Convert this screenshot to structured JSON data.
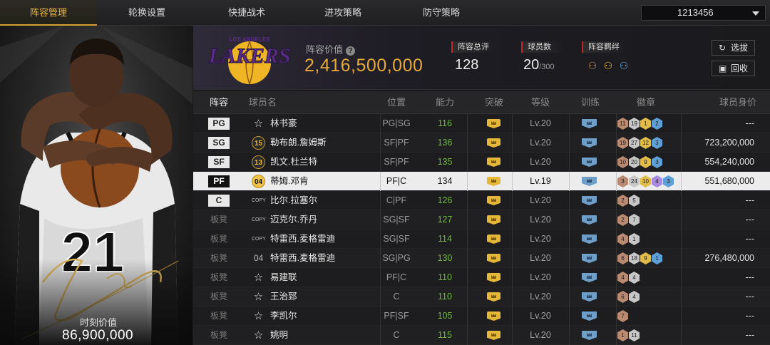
{
  "nav": {
    "tabs": [
      {
        "label": "阵容管理",
        "active": true
      },
      {
        "label": "轮换设置",
        "active": false
      },
      {
        "label": "快捷战术",
        "active": false
      },
      {
        "label": "进攻策略",
        "active": false
      },
      {
        "label": "防守策略",
        "active": false
      }
    ],
    "account_id": "1213456"
  },
  "player_card": {
    "jersey_number": "21",
    "moment_value_label": "时刻价值",
    "moment_value": "86,900,000"
  },
  "summary": {
    "team_logo_text": "LAKERS",
    "team_logo_arc": "LOS ANGELES",
    "lineup_value_label": "阵容价值",
    "lineup_value": "2,416,500,000",
    "overall_label": "阵容总评",
    "overall_value": "128",
    "player_count_label": "球员数",
    "player_count": "20",
    "player_count_max": "/300",
    "bond_label": "阵容羁绊",
    "buttons": {
      "select_label": "选拔",
      "recycle_label": "回收"
    }
  },
  "colors": {
    "accent_gold": "#e6a93a",
    "ability_green": "#6fba3f",
    "brand_red": "#c0262c",
    "lakers_purple": "#552583"
  },
  "table": {
    "headers": [
      "阵容",
      "球员名",
      "位置",
      "能力",
      "突破",
      "等级",
      "训练",
      "徽章",
      "球员身价"
    ],
    "rows": [
      {
        "slot": "PG",
        "slot_type": "starter",
        "jersey": "☆",
        "jersey_type": "star",
        "name": "林书豪",
        "position": "PG|SG",
        "ability": "116",
        "level": "Lv.20",
        "badges": [
          {
            "v": "11",
            "c": "bronze"
          },
          {
            "v": "19",
            "c": "silver"
          },
          {
            "v": "1",
            "c": "gold"
          },
          {
            "v": "2",
            "c": "blue"
          }
        ],
        "price": "---"
      },
      {
        "slot": "SG",
        "slot_type": "starter",
        "jersey": "15",
        "jersey_type": "gold",
        "name": "勒布朗.詹姆斯",
        "position": "SF|PF",
        "ability": "136",
        "level": "Lv.20",
        "badges": [
          {
            "v": "19",
            "c": "bronze"
          },
          {
            "v": "27",
            "c": "silver"
          },
          {
            "v": "12",
            "c": "gold"
          },
          {
            "v": "3",
            "c": "blue"
          }
        ],
        "price": "723,200,000"
      },
      {
        "slot": "SF",
        "slot_type": "starter",
        "jersey": "13",
        "jersey_type": "gold",
        "name": "凯文.杜兰特",
        "position": "SF|PF",
        "ability": "135",
        "level": "Lv.20",
        "badges": [
          {
            "v": "10",
            "c": "bronze"
          },
          {
            "v": "20",
            "c": "silver"
          },
          {
            "v": "9",
            "c": "gold"
          },
          {
            "v": "3",
            "c": "blue"
          }
        ],
        "price": "554,240,000"
      },
      {
        "slot": "PF",
        "slot_type": "starter",
        "selected": true,
        "jersey": "04",
        "jersey_type": "gold",
        "name": "蒂姆.邓肯",
        "position": "PF|C",
        "ability": "134",
        "level": "Lv.19",
        "badges": [
          {
            "v": "3",
            "c": "bronze"
          },
          {
            "v": "24",
            "c": "silver"
          },
          {
            "v": "10",
            "c": "gold"
          },
          {
            "v": "4",
            "c": "purple"
          },
          {
            "v": "3",
            "c": "blue"
          }
        ],
        "price": "551,680,000"
      },
      {
        "slot": "C",
        "slot_type": "starter",
        "jersey": "COPY",
        "jersey_type": "copy",
        "name": "比尔.拉塞尔",
        "position": "C|PF",
        "ability": "126",
        "level": "Lv.20",
        "badges": [
          {
            "v": "2",
            "c": "bronze"
          },
          {
            "v": "5",
            "c": "silver"
          }
        ],
        "price": "---"
      },
      {
        "slot": "板凳",
        "slot_type": "bench",
        "jersey": "COPY",
        "jersey_type": "copy",
        "name": "迈克尔.乔丹",
        "position": "SG|SF",
        "ability": "127",
        "level": "Lv.20",
        "badges": [
          {
            "v": "2",
            "c": "bronze"
          },
          {
            "v": "7",
            "c": "silver"
          }
        ],
        "price": "---"
      },
      {
        "slot": "板凳",
        "slot_type": "bench",
        "jersey": "COPY",
        "jersey_type": "copy",
        "name": "特雷西.麦格雷迪",
        "position": "SG|SF",
        "ability": "114",
        "level": "Lv.20",
        "badges": [
          {
            "v": "4",
            "c": "bronze"
          },
          {
            "v": "1",
            "c": "silver"
          }
        ],
        "price": "---"
      },
      {
        "slot": "板凳",
        "slot_type": "bench",
        "jersey": "04",
        "jersey_type": "num",
        "name": "特雷西.麦格雷迪",
        "position": "SG|PG",
        "ability": "130",
        "level": "Lv.20",
        "badges": [
          {
            "v": "6",
            "c": "bronze"
          },
          {
            "v": "18",
            "c": "silver"
          },
          {
            "v": "9",
            "c": "gold"
          },
          {
            "v": "1",
            "c": "blue"
          }
        ],
        "price": "276,480,000"
      },
      {
        "slot": "板凳",
        "slot_type": "bench",
        "jersey": "☆",
        "jersey_type": "star",
        "name": "易建联",
        "position": "PF|C",
        "ability": "110",
        "level": "Lv.20",
        "badges": [
          {
            "v": "4",
            "c": "bronze"
          },
          {
            "v": "4",
            "c": "silver"
          }
        ],
        "price": "---"
      },
      {
        "slot": "板凳",
        "slot_type": "bench",
        "jersey": "☆",
        "jersey_type": "star",
        "name": "王治郅",
        "position": "C",
        "ability": "110",
        "level": "Lv.20",
        "badges": [
          {
            "v": "6",
            "c": "bronze"
          },
          {
            "v": "4",
            "c": "silver"
          }
        ],
        "price": "---"
      },
      {
        "slot": "板凳",
        "slot_type": "bench",
        "jersey": "☆",
        "jersey_type": "star",
        "name": "李凯尔",
        "position": "PF|SF",
        "ability": "105",
        "level": "Lv.20",
        "badges": [
          {
            "v": "7",
            "c": "bronze"
          }
        ],
        "price": "---"
      },
      {
        "slot": "板凳",
        "slot_type": "bench",
        "jersey": "☆",
        "jersey_type": "star",
        "name": "姚明",
        "position": "C",
        "ability": "115",
        "level": "Lv.20",
        "badges": [
          {
            "v": "1",
            "c": "bronze"
          },
          {
            "v": "11",
            "c": "silver"
          }
        ],
        "price": "---"
      }
    ]
  }
}
